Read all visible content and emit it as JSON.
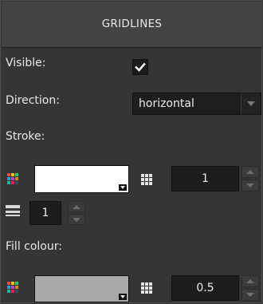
{
  "header": {
    "title": "GRIDLINES"
  },
  "visible": {
    "label": "Visible:",
    "checked": true
  },
  "direction": {
    "label": "Direction:",
    "value": "horizontal",
    "icon": "chevron-down-icon"
  },
  "stroke": {
    "label": "Stroke:",
    "color": "#ffffff",
    "opacity": "1",
    "width": "1"
  },
  "fill": {
    "label": "Fill colour:",
    "color": "#a8a8a8",
    "opacity": "0.5"
  },
  "icons": {
    "palette": "color-palette-icon",
    "opacity": "opacity-grid-icon",
    "stroke_width": "line-width-icon"
  }
}
